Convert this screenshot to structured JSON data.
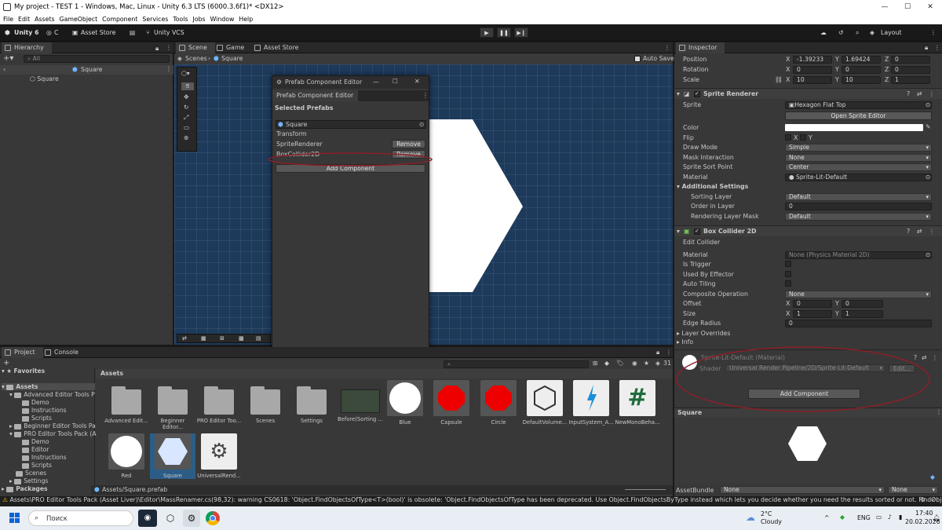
{
  "window": {
    "title": "My project - TEST 1 - Windows, Mac, Linux - Unity 6.3 LTS (6000.3.6f1)* <DX12>",
    "min": "—",
    "max": "☐",
    "close": "✕"
  },
  "menu": [
    "File",
    "Edit",
    "Assets",
    "GameObject",
    "Component",
    "Services",
    "Tools",
    "Jobs",
    "Window",
    "Help"
  ],
  "toolbar": {
    "account": "Unity 6",
    "cloud": "C",
    "asset_store": "Asset Store",
    "vcs": "Unity VCS",
    "layout": "Layout"
  },
  "hierarchy": {
    "tab": "Hierarchy",
    "search_placeholder": "All",
    "scene_name": "Square",
    "item": "Square"
  },
  "scene": {
    "tabs": [
      "Scene",
      "Game",
      "Asset Store"
    ],
    "breadcrumb_root": "Scenes",
    "breadcrumb_item": "Square",
    "auto_save": "Auto Save"
  },
  "prefab_editor": {
    "title": "Prefab Component Editor",
    "tab": "Prefab Component Editor",
    "selected_label": "Selected Prefabs",
    "prefab": "Square",
    "components": [
      {
        "name": "Transform",
        "action": ""
      },
      {
        "name": "SpriteRenderer",
        "action": "Remove"
      },
      {
        "name": "BoxCollider2D",
        "action": "Remove"
      }
    ],
    "add_button": "Add Component"
  },
  "project": {
    "tabs": [
      "Project",
      "Console"
    ],
    "favorites": "Favorites",
    "assets_label": "Assets",
    "tree": [
      {
        "label": "Assets",
        "depth": 0
      },
      {
        "label": "Advanced Editor Tools P",
        "depth": 1
      },
      {
        "label": "Demo",
        "depth": 2
      },
      {
        "label": "Instructions",
        "depth": 2
      },
      {
        "label": "Scripts",
        "depth": 2
      },
      {
        "label": "Beginner Editor Tools Pa",
        "depth": 1
      },
      {
        "label": "PRO Editor Tools Pack (A",
        "depth": 1
      },
      {
        "label": "Demo",
        "depth": 2
      },
      {
        "label": "Editor",
        "depth": 2
      },
      {
        "label": "Instructions",
        "depth": 2
      },
      {
        "label": "Scripts",
        "depth": 2
      },
      {
        "label": "Scenes",
        "depth": 1
      },
      {
        "label": "Settings",
        "depth": 1
      }
    ],
    "packages": "Packages",
    "assets_row1": [
      "Advanced Edit...",
      "Beginner Editor...",
      "PRO Editor Too...",
      "Scenes",
      "Settings",
      "Before(Sorting ...",
      "Blue",
      "Capsule",
      "Circle",
      "DefaultVolume...",
      "InputSystem_A...",
      "NewMonoBeha..."
    ],
    "assets_row2": [
      "Red",
      "Square",
      "UniversalRend..."
    ],
    "path": "Assets/Square.prefab",
    "count": "31"
  },
  "inspector": {
    "tab": "Inspector",
    "transform": [
      {
        "label": "Position",
        "x": "-1.39233",
        "y": "1.69424",
        "z": "0"
      },
      {
        "label": "Rotation",
        "x": "0",
        "y": "0",
        "z": "0"
      },
      {
        "label": "Scale",
        "x": "10",
        "y": "10",
        "z": "1"
      }
    ],
    "sprite_renderer": {
      "title": "Sprite Renderer",
      "sprite_label": "Sprite",
      "sprite_value": "Hexagon Flat Top",
      "open_editor": "Open Sprite Editor",
      "color_label": "Color",
      "flip_label": "Flip",
      "flip_x": "X",
      "flip_y": "Y",
      "draw_mode_label": "Draw Mode",
      "draw_mode": "Simple",
      "mask_label": "Mask Interaction",
      "mask": "None",
      "sort_point_label": "Sprite Sort Point",
      "sort_point": "Center",
      "material_label": "Material",
      "material": "Sprite-Lit-Default",
      "additional": "Additional Settings",
      "sorting_layer_label": "Sorting Layer",
      "sorting_layer": "Default",
      "order_label": "Order in Layer",
      "order": "0",
      "rendering_layer_label": "Rendering Layer Mask",
      "rendering_layer": "Default"
    },
    "box_collider": {
      "title": "Box Collider 2D",
      "edit_collider": "Edit Collider",
      "material_label": "Material",
      "material": "None (Physics Material 2D)",
      "trigger": "Is Trigger",
      "effector": "Used By Effector",
      "tiling": "Auto Tiling",
      "composite_label": "Composite Operation",
      "composite": "None",
      "offset_label": "Offset",
      "offset_x": "0",
      "offset_y": "0",
      "size_label": "Size",
      "size_x": "1",
      "size_y": "1",
      "radius_label": "Edge Radius",
      "radius": "0",
      "overrides": "Layer Overrides",
      "info": "Info"
    },
    "material": {
      "name": "Sprite-Lit-Default (Material)",
      "shader_label": "Shader",
      "shader": "Universal Render Pipeline/2D/Sprite-Lit-Default",
      "edit": "Edit..."
    },
    "add_component": "Add Component",
    "preview_title": "Square",
    "assetbundle_label": "AssetBundle",
    "assetbundle": "None",
    "assetbundle_variant": "None"
  },
  "status": "Assets\\PRO Editor Tools Pack (Asset Liver)\\Editor\\MassRenamer.cs(98,32): warning CS0618: 'Object.FindObjectsOfType<T>(bool)' is obsolete: 'Object.FindObjectsOfType has been deprecated. Use Object.FindObjectsByType instead which lets you decide whether you need the results sorted or not.  FindObjectsOf",
  "taskbar": {
    "search": "Поиск",
    "weather_temp": "2°C",
    "weather_text": "Cloudy",
    "lang": "ENG",
    "time": "17:40",
    "date": "20.02.2026"
  }
}
